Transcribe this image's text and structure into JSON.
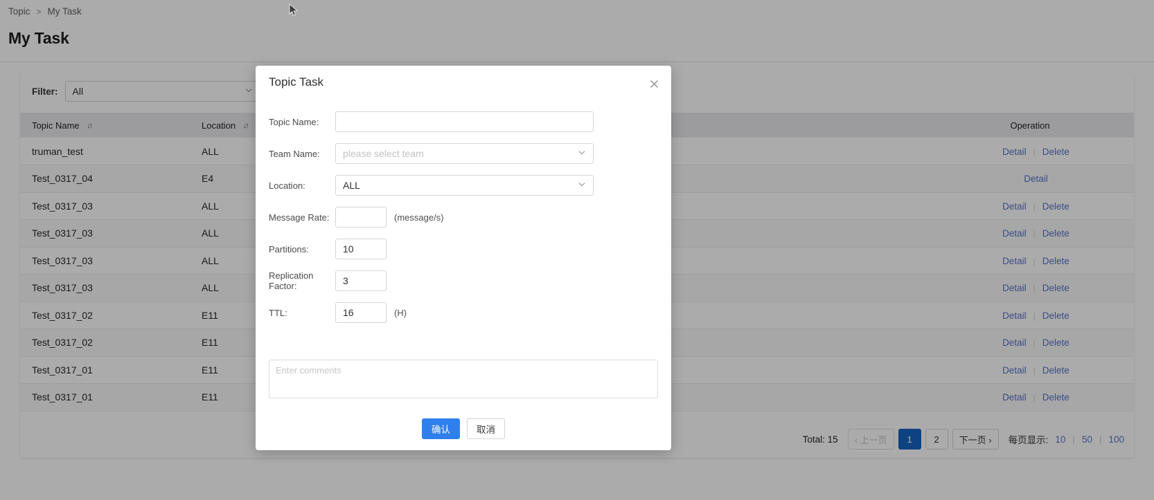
{
  "breadcrumb": {
    "items": [
      "Topic",
      "My Task"
    ],
    "separator": ">"
  },
  "page": {
    "title": "My Task"
  },
  "filter": {
    "label": "Filter:",
    "value": "All",
    "chevron": "chevron-down-icon"
  },
  "table": {
    "columns": [
      "Topic Name",
      "Location",
      "Operation"
    ],
    "sort_icon": "↓↑",
    "rows": [
      {
        "topic_name": "truman_test",
        "location": "ALL",
        "actions": [
          "Detail",
          "Delete"
        ]
      },
      {
        "topic_name": "Test_0317_04",
        "location": "E4",
        "actions": [
          "Detail"
        ]
      },
      {
        "topic_name": "Test_0317_03",
        "location": "ALL",
        "actions": [
          "Detail",
          "Delete"
        ]
      },
      {
        "topic_name": "Test_0317_03",
        "location": "ALL",
        "actions": [
          "Detail",
          "Delete"
        ]
      },
      {
        "topic_name": "Test_0317_03",
        "location": "ALL",
        "actions": [
          "Detail",
          "Delete"
        ]
      },
      {
        "topic_name": "Test_0317_03",
        "location": "ALL",
        "actions": [
          "Detail",
          "Delete"
        ]
      },
      {
        "topic_name": "Test_0317_02",
        "location": "E11",
        "actions": [
          "Detail",
          "Delete"
        ]
      },
      {
        "topic_name": "Test_0317_02",
        "location": "E11",
        "actions": [
          "Detail",
          "Delete"
        ]
      },
      {
        "topic_name": "Test_0317_01",
        "location": "E11",
        "actions": [
          "Detail",
          "Delete"
        ]
      },
      {
        "topic_name": "Test_0317_01",
        "location": "E11",
        "actions": [
          "Detail",
          "Delete"
        ]
      }
    ]
  },
  "pagination": {
    "total": "Total: 15",
    "prev": "‹ 上一页",
    "pages": [
      "1",
      "2"
    ],
    "active_page": "1",
    "next": "下一页 ›",
    "pagesize_label": "每页显示:",
    "pagesize_options": [
      "10",
      "50",
      "100"
    ]
  },
  "modal": {
    "title": "Topic Task",
    "close_icon": "close-icon",
    "fields": [
      {
        "label": "Topic Name:",
        "value": "",
        "placeholder": "",
        "kind": "text",
        "width": "wide"
      },
      {
        "label": "Team Name:",
        "value": "",
        "placeholder": "please select team",
        "kind": "select",
        "width": "wide"
      },
      {
        "label": "Location:",
        "value": "ALL",
        "placeholder": "",
        "kind": "select",
        "width": "wide"
      },
      {
        "label": "Message Rate:",
        "value": "",
        "placeholder": "",
        "kind": "text",
        "width": "narrow",
        "suffix": "(message/s)"
      },
      {
        "label": "Partitions:",
        "value": "10",
        "placeholder": "",
        "kind": "text",
        "width": "narrow",
        "suffix": ""
      },
      {
        "label": "Replication Factor:",
        "value": "3",
        "placeholder": "",
        "kind": "text",
        "width": "narrow",
        "suffix": ""
      },
      {
        "label": "TTL:",
        "value": "16",
        "placeholder": "",
        "kind": "text",
        "width": "narrow",
        "suffix": "(H)"
      }
    ],
    "comments_placeholder": "Enter comments",
    "confirm_label": "确认",
    "cancel_label": "取消"
  },
  "colors": {
    "primary": "#2f80ed",
    "page_active": "#1665c0",
    "link": "#5a72c9",
    "header_bg": "#e9e9ec"
  }
}
